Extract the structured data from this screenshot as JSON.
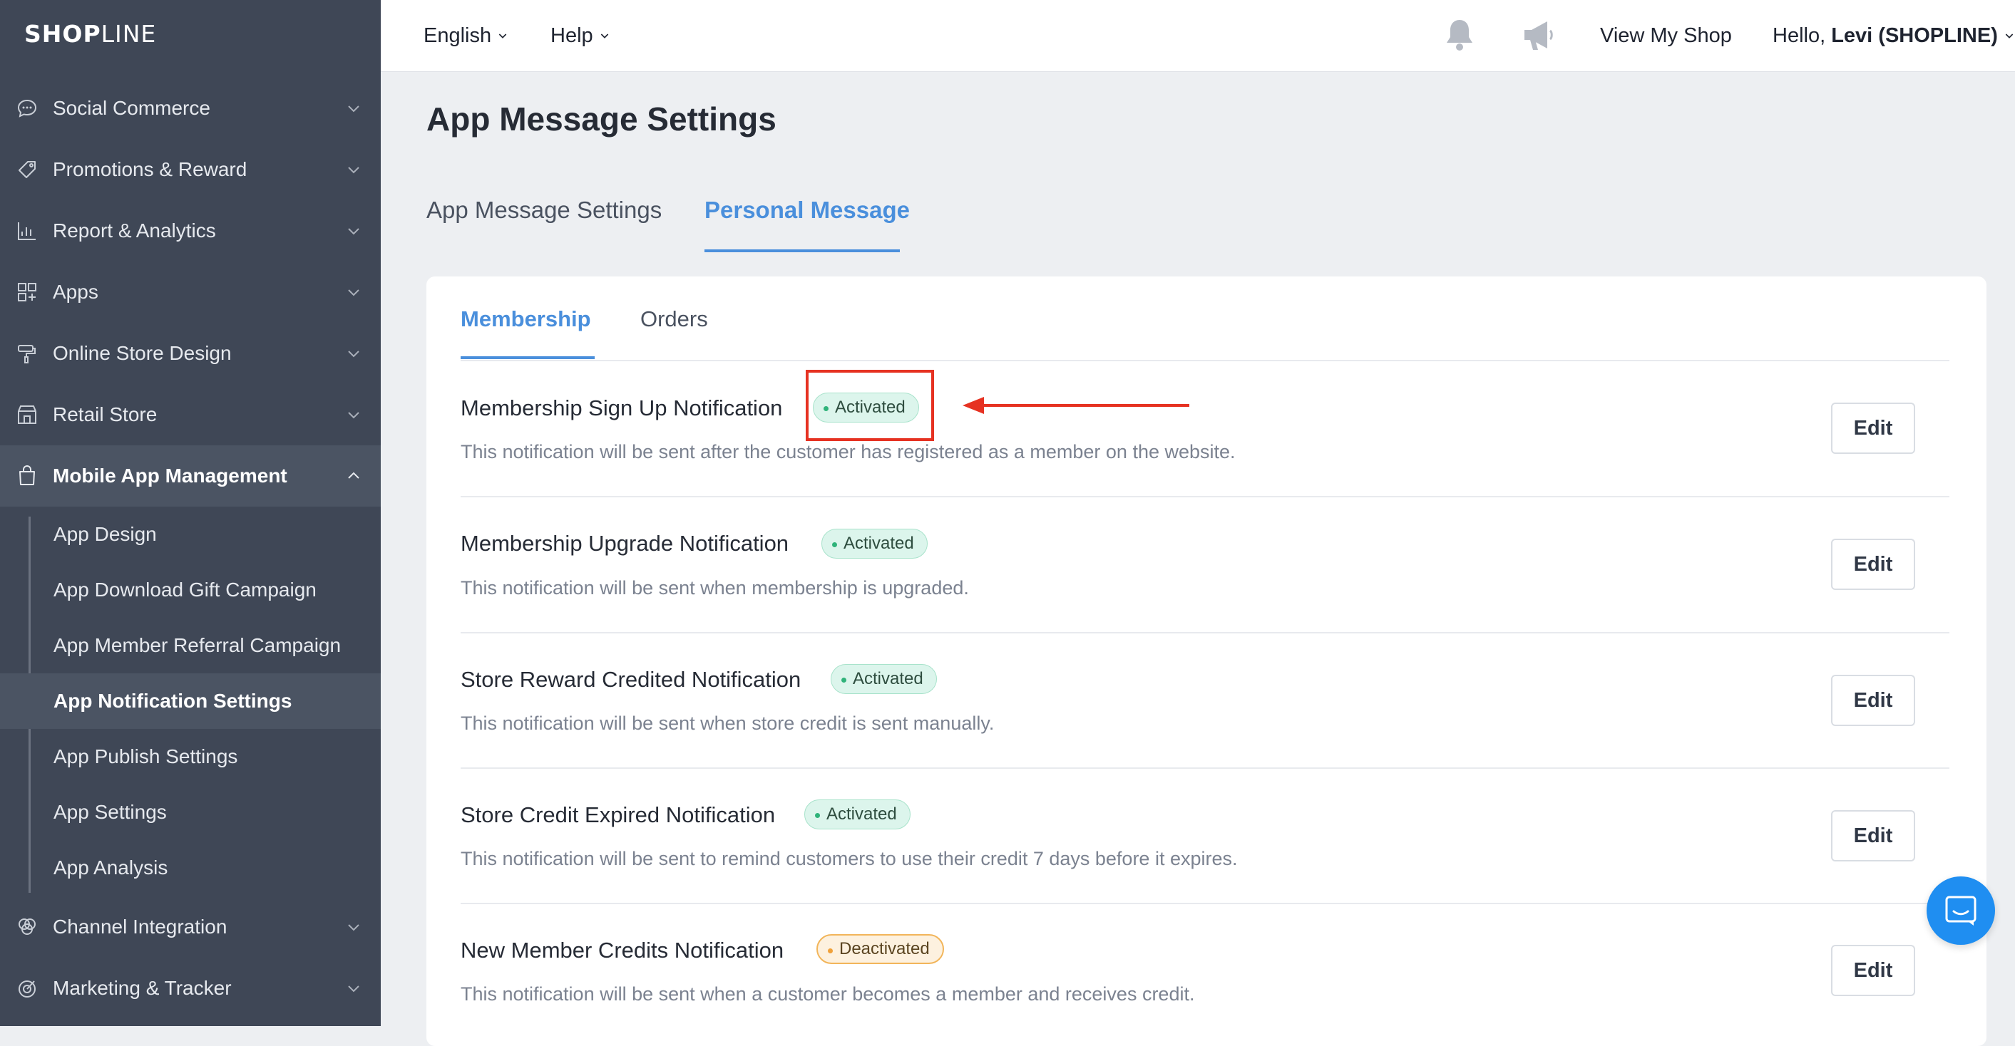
{
  "brand": {
    "logo_bold": "SHOP",
    "logo_thin": "LINE"
  },
  "sidebar": {
    "items": [
      {
        "label": "Social Commerce",
        "icon": "chat-bubble-icon"
      },
      {
        "label": "Promotions & Reward",
        "icon": "tag-icon"
      },
      {
        "label": "Report & Analytics",
        "icon": "chart-icon"
      },
      {
        "label": "Apps",
        "icon": "apps-grid-icon"
      },
      {
        "label": "Online Store Design",
        "icon": "paint-roller-icon"
      },
      {
        "label": "Retail Store",
        "icon": "storefront-icon"
      },
      {
        "label": "Mobile App Management",
        "icon": "shopping-bag-icon",
        "expanded": true
      }
    ],
    "sub_items": [
      {
        "label": "App Design"
      },
      {
        "label": "App Download Gift Campaign"
      },
      {
        "label": "App Member Referral Campaign"
      },
      {
        "label": "App Notification Settings",
        "active": true
      },
      {
        "label": "App Publish Settings"
      },
      {
        "label": "App Settings"
      },
      {
        "label": "App Analysis"
      }
    ],
    "bottom_items": [
      {
        "label": "Channel Integration",
        "icon": "circles-icon"
      },
      {
        "label": "Marketing & Tracker",
        "icon": "target-icon"
      }
    ]
  },
  "topbar": {
    "language": "English",
    "help": "Help",
    "view_shop": "View My Shop",
    "hello_prefix": "Hello, ",
    "hello_user": "Levi (SHOPLINE)"
  },
  "page": {
    "title": "App Message Settings",
    "tabs": [
      {
        "label": "App Message Settings"
      },
      {
        "label": "Personal Message",
        "active": true
      }
    ],
    "subtabs": [
      {
        "label": "Membership",
        "active": true
      },
      {
        "label": "Orders"
      }
    ]
  },
  "notifications": [
    {
      "title": "Membership Sign Up Notification",
      "status": "Activated",
      "description": "This notification will be sent after the customer has registered as a member on the website.",
      "action": "Edit"
    },
    {
      "title": "Membership Upgrade Notification",
      "status": "Activated",
      "description": "This notification will be sent when membership is upgraded.",
      "action": "Edit"
    },
    {
      "title": "Store Reward Credited Notification",
      "status": "Activated",
      "description": "This notification will be sent when store credit is sent manually.",
      "action": "Edit"
    },
    {
      "title": "Store Credit Expired Notification",
      "status": "Activated",
      "description": "This notification will be sent to remind customers to use their credit 7 days before it expires.",
      "action": "Edit"
    },
    {
      "title": "New Member Credits Notification",
      "status": "Deactivated",
      "description": "This notification will be sent when a customer becomes a member and receives credit.",
      "action": "Edit"
    }
  ],
  "colors": {
    "sidebar_bg": "#3f4756",
    "accent": "#4a8fdc",
    "activated_green": "#2fb37a",
    "deactivated_orange": "#f0a13a",
    "annotation_red": "#e63222"
  }
}
